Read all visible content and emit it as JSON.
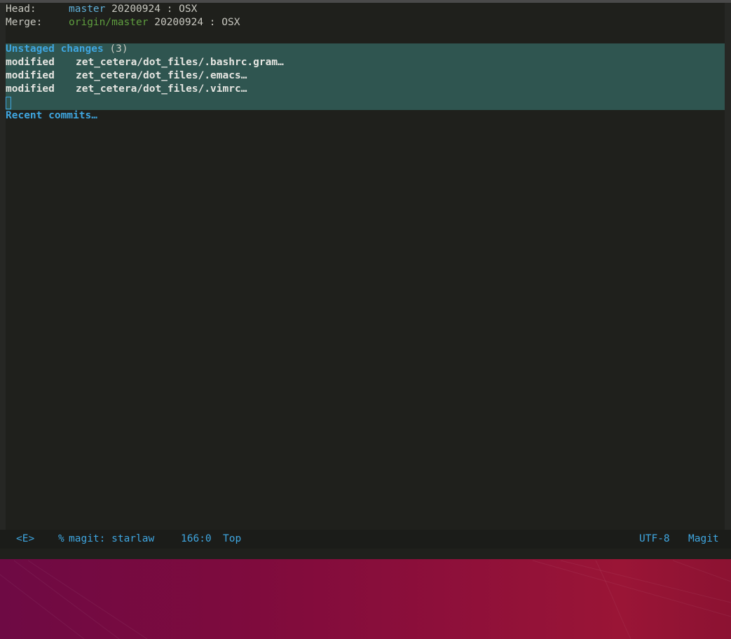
{
  "header": {
    "head_label": "Head:",
    "head_branch": "master",
    "head_commit": "20200924 : OSX",
    "merge_label": "Merge:",
    "merge_branch": "origin/master",
    "merge_commit": "20200924 : OSX"
  },
  "unstaged": {
    "heading": "Unstaged changes",
    "count": "(3)",
    "files": [
      {
        "status": "modified",
        "path": "zet_cetera/dot_files/.bashrc.gram…"
      },
      {
        "status": "modified",
        "path": "zet_cetera/dot_files/.emacs…"
      },
      {
        "status": "modified",
        "path": "zet_cetera/dot_files/.vimrc…"
      }
    ]
  },
  "recent_commits": {
    "heading": "Recent commits…"
  },
  "modeline": {
    "state": "<E>",
    "modified_flag": "%",
    "buffer_name": "magit: starlaw",
    "position": "166:0",
    "scroll": "Top",
    "encoding": "UTF-8",
    "major_mode": "Magit"
  },
  "colors": {
    "background": "#1f201c",
    "section_highlight": "#2f5550",
    "heading": "#3fa6e0",
    "local_branch": "#5fafd7",
    "remote_branch": "#5f9f3f",
    "desktop": "#7d0c3c"
  }
}
